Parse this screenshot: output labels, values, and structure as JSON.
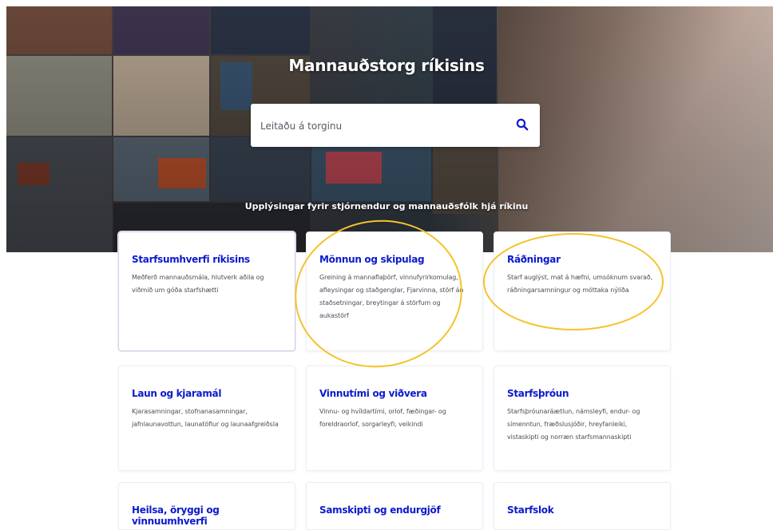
{
  "hero": {
    "title": "Mannauðstorg ríkisins",
    "subtitle": "Upplýsingar fyrir stjórnendur og mannauðsfólk hjá ríkinu",
    "search": {
      "placeholder": "Leitaðu á torginu",
      "icon": "search-icon"
    }
  },
  "cards": [
    {
      "title": "Starfsumhverfi ríkisins",
      "description": "Meðferð mannauðsmála, hlutverk aðila og viðmið um góða starfshætti"
    },
    {
      "title": "Mönnun og skipulag",
      "description": "Greining á mannaflaþörf, vinnufyrirkomulag, afleysingar og staðgenglar, Fjarvinna, störf án staðsetningar, breytingar á störfum og aukastörf"
    },
    {
      "title": "Ráðningar",
      "description": "Starf auglýst, mat á hæfni, umsóknum svarað, ráðningarsamningur og móttaka nýliða"
    },
    {
      "title": "Laun og kjaramál",
      "description": "Kjarasamningar, stofnanasamningar, jafnlaunavottun, launatöflur og launaafgreiðsla"
    },
    {
      "title": "Vinnutími og viðvera",
      "description": "Vinnu- og hvíldartími, orlof, fæðingar- og foreldraorlof, sorgarleyfi, veikindi"
    },
    {
      "title": "Starfsþróun",
      "description": "Starfsþróunaráætlun, námsleyfi, endur- og símenntun, fræðslusjóðir, hreyfanleiki, vistaskipti og norræn starfsmannaskipti"
    },
    {
      "title": "Heilsa, öryggi og vinnuumhverfi",
      "description": ""
    },
    {
      "title": "Samskipti og endurgjöf",
      "description": ""
    },
    {
      "title": "Starfslok",
      "description": ""
    }
  ],
  "colors": {
    "accent": "#0c1acd",
    "annotation": "#f6c22a",
    "text": "#4b4f58"
  }
}
